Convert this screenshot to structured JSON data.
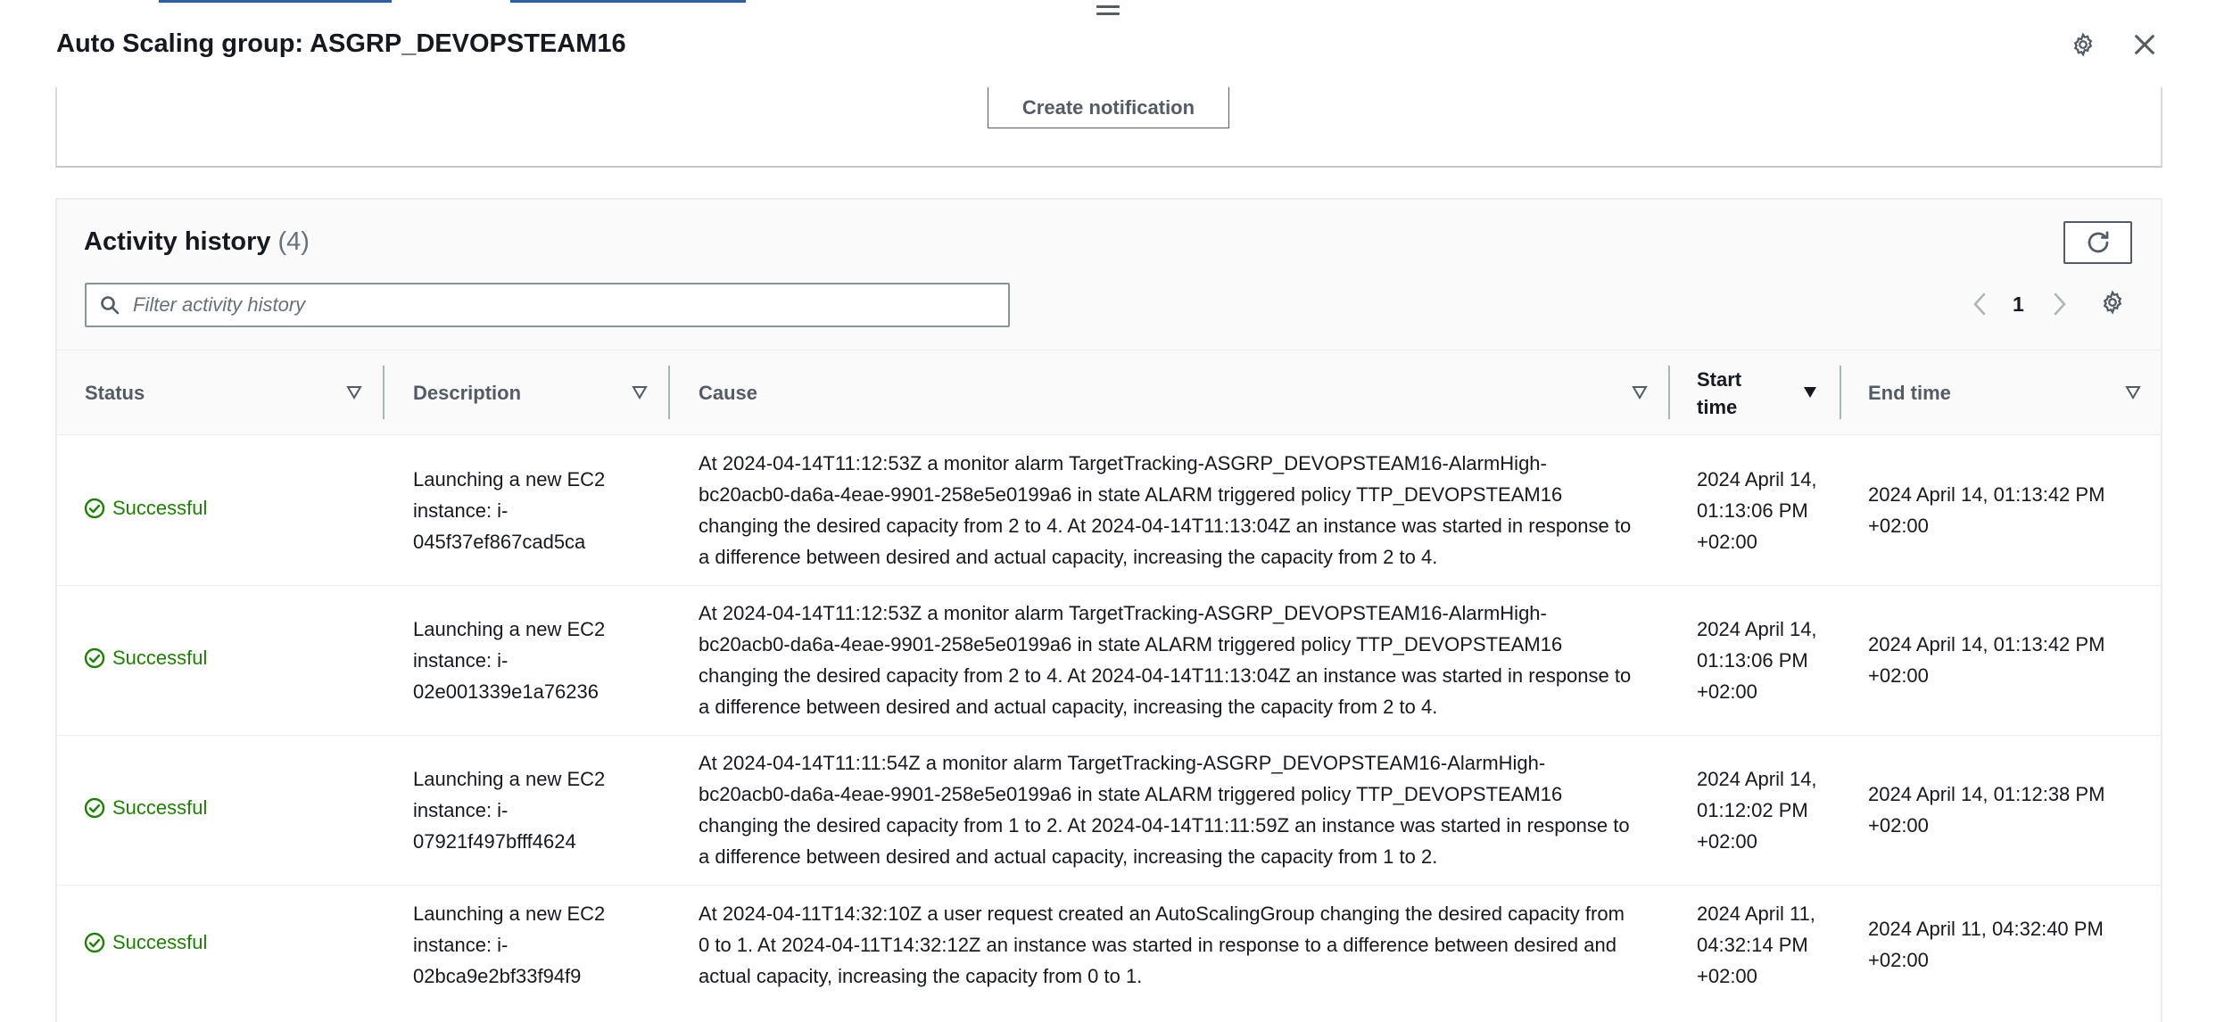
{
  "panel": {
    "title": "Auto Scaling group: ASGRP_DEVOPSTEAM16"
  },
  "notifications": {
    "create_button": "Create notification"
  },
  "activity": {
    "title": "Activity history",
    "count": "(4)",
    "filter_placeholder": "Filter activity history",
    "page": "1",
    "columns": {
      "status": "Status",
      "description": "Description",
      "cause": "Cause",
      "start_time": "Start time",
      "end_time": "End time"
    },
    "rows": [
      {
        "status": "Successful",
        "description": "Launching a new EC2 instance: i-045f37ef867cad5ca",
        "cause": "At 2024-04-14T11:12:53Z a monitor alarm TargetTracking-ASGRP_DEVOPSTEAM16-AlarmHigh-bc20acb0-da6a-4eae-9901-258e5e0199a6 in state ALARM triggered policy TTP_DEVOPSTEAM16 changing the desired capacity from 2 to 4. At 2024-04-14T11:13:04Z an instance was started in response to a difference between desired and actual capacity, increasing the capacity from 2 to 4.",
        "start_time": "2024 April 14, 01:13:06 PM +02:00",
        "end_time": "2024 April 14, 01:13:42 PM +02:00"
      },
      {
        "status": "Successful",
        "description": "Launching a new EC2 instance: i-02e001339e1a76236",
        "cause": "At 2024-04-14T11:12:53Z a monitor alarm TargetTracking-ASGRP_DEVOPSTEAM16-AlarmHigh-bc20acb0-da6a-4eae-9901-258e5e0199a6 in state ALARM triggered policy TTP_DEVOPSTEAM16 changing the desired capacity from 2 to 4. At 2024-04-14T11:13:04Z an instance was started in response to a difference between desired and actual capacity, increasing the capacity from 2 to 4.",
        "start_time": "2024 April 14, 01:13:06 PM +02:00",
        "end_time": "2024 April 14, 01:13:42 PM +02:00"
      },
      {
        "status": "Successful",
        "description": "Launching a new EC2 instance: i-07921f497bfff4624",
        "cause": "At 2024-04-14T11:11:54Z a monitor alarm TargetTracking-ASGRP_DEVOPSTEAM16-AlarmHigh-bc20acb0-da6a-4eae-9901-258e5e0199a6 in state ALARM triggered policy TTP_DEVOPSTEAM16 changing the desired capacity from 1 to 2. At 2024-04-14T11:11:59Z an instance was started in response to a difference between desired and actual capacity, increasing the capacity from 1 to 2.",
        "start_time": "2024 April 14, 01:12:02 PM +02:00",
        "end_time": "2024 April 14, 01:12:38 PM +02:00"
      },
      {
        "status": "Successful",
        "description": "Launching a new EC2 instance: i-02bca9e2bf33f94f9",
        "cause": "At 2024-04-11T14:32:10Z a user request created an AutoScalingGroup changing the desired capacity from 0 to 1. At 2024-04-11T14:32:12Z an instance was started in response to a difference between desired and actual capacity, increasing the capacity from 0 to 1.",
        "start_time": "2024 April 11, 04:32:14 PM +02:00",
        "end_time": "2024 April 11, 04:32:40 PM +02:00"
      }
    ]
  },
  "colors": {
    "success": "#1d8102",
    "text": "#16191f",
    "muted": "#545b64"
  }
}
